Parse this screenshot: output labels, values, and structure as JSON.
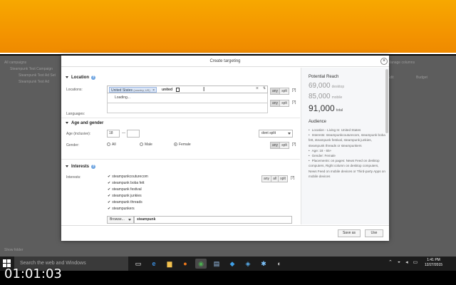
{
  "background_app": {
    "left_items": [
      "All campaigns",
      "Steampunk Test Campaign",
      "Steampunk Test Ad Set",
      "Steampunk Test Ad"
    ],
    "right_items": [
      "Manage columns",
      "Edit",
      "Budget"
    ],
    "bottom": "Show folder"
  },
  "modal": {
    "title": "Create targeting",
    "close_icon": "×",
    "location": {
      "heading": "Location",
      "locations_label": "Locations:",
      "token": "United States",
      "token_note": "(country, US)",
      "typed_text": "united",
      "dropdown_text": "Loading...",
      "languages_label": "Languages:"
    },
    "segments": [
      "any",
      "splt",
      "[?]"
    ],
    "age_gender": {
      "heading": "Age and gender",
      "age_label": "Age (inclusive):",
      "age_min": "18",
      "dash": "—",
      "age_max": "",
      "split_select": "dont split",
      "gender_label": "Gender:",
      "options": [
        "All",
        "Male",
        "Female"
      ]
    },
    "interests": {
      "heading": "Interests",
      "label": "Interests:",
      "segments": [
        "any",
        "all",
        "splt",
        "[?]"
      ],
      "items": [
        "steampunkcouturecom",
        "steampunk boba fett",
        "steampunk festival",
        "steampunk junkies",
        "steampunk threads",
        "steampunkers"
      ],
      "browse_label": "Browse...",
      "search_value": "steampunk"
    },
    "reach": {
      "title": "Potential Reach",
      "desktop_value": "69,000",
      "desktop_label": "desktop",
      "mobile_value": "85,000",
      "mobile_label": "mobile",
      "total_value": "91,000",
      "total_label": "total"
    },
    "audience": {
      "title": "Audience",
      "items": [
        "Location - Living In: United States",
        "Interests: steampunkcouturecom, steampunk boba fett, steampunk festival, steampunk junkies, steampunk threads or steampunkers",
        "Age: 18 - 65+",
        "Gender: Female",
        "Placements: on pages: News Feed on desktop computers, Right column on desktop computers, News Feed on mobile devices or Third-party Apps on mobile devices"
      ]
    },
    "footer": {
      "save_as": "Save as",
      "use": "Use"
    }
  },
  "taskbar": {
    "search_placeholder": "Search the web and Windows",
    "time": "1:41 PM",
    "date": "12/27/2015"
  },
  "video_timer": "01:01:03"
}
